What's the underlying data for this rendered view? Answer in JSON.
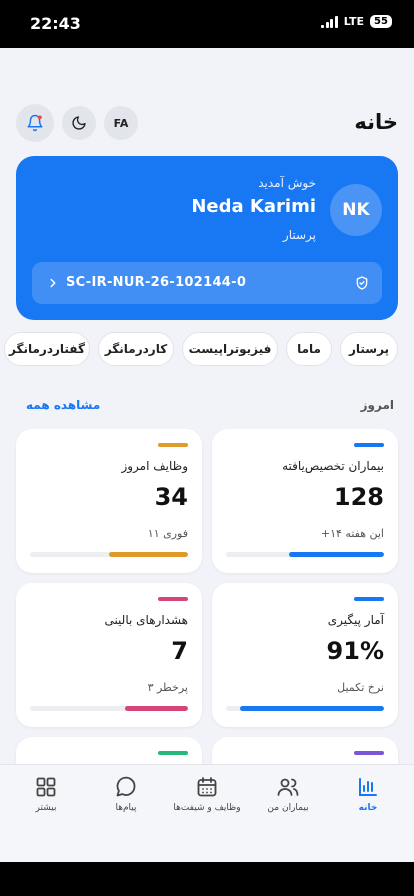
{
  "status": {
    "time": "22:43",
    "network": "LTE",
    "battery": "55"
  },
  "header": {
    "title": "خانه",
    "lang_label": "FA"
  },
  "welcome": {
    "greeting": "خوش آمدید",
    "name": "Neda Karimi",
    "role": "پرستار",
    "avatar_initials": "NK",
    "staff_id": "SC-IR-NUR-26-102144-0"
  },
  "roles": [
    "پرستار",
    "ماما",
    "فیزیوتراپیست",
    "کاردرمانگر",
    "گفتاردرمانگر"
  ],
  "today": {
    "title": "امروز",
    "see_all": "مشاهده همه"
  },
  "cards": [
    {
      "title": "بیماران تخصیص‌یافته",
      "value": "128",
      "sub": "+۱۴ این هفته",
      "progress": 0.6,
      "color": "#1877f2"
    },
    {
      "title": "وظایف امروز",
      "value": "34",
      "sub": "۱۱ فوری",
      "progress": 0.5,
      "color": "#e09a2a"
    },
    {
      "title": "آمار پیگیری",
      "value": "91%",
      "sub": "نرخ تکمیل",
      "progress": 0.91,
      "color": "#1877f2"
    },
    {
      "title": "هشدارهای بالینی",
      "value": "7",
      "sub": "۳ پرخطر",
      "progress": 0.4,
      "color": "#d6457a"
    },
    {
      "color": "#7b57d6"
    },
    {
      "color": "#27b87a"
    }
  ],
  "tabs": [
    {
      "label": "خانه",
      "icon": "chart-icon",
      "active": true
    },
    {
      "label": "بیماران من",
      "icon": "users-icon",
      "active": false
    },
    {
      "label": "وظایف و شیفت‌ها",
      "icon": "calendar-icon",
      "active": false
    },
    {
      "label": "پیام‌ها",
      "icon": "chat-icon",
      "active": false
    },
    {
      "label": "بیشتر",
      "icon": "grid-icon",
      "active": false
    }
  ],
  "colors": {
    "accent": "#1877f2",
    "background": "#f2f3f8"
  }
}
